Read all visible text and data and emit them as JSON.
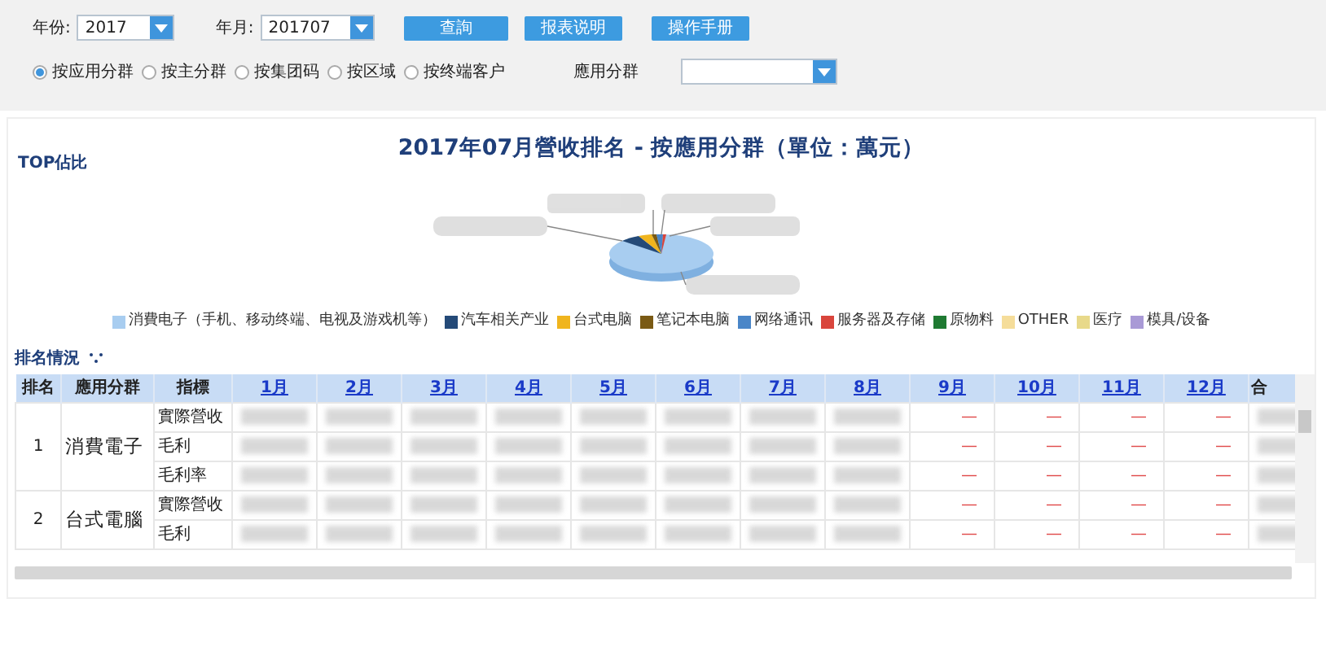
{
  "filters": {
    "year": {
      "label": "年份:",
      "value": "2017"
    },
    "month": {
      "label": "年月:",
      "value": "201707"
    },
    "buttons": [
      "查詢",
      "报表说明",
      "操作手册"
    ],
    "radios": [
      {
        "label": "按应用分群",
        "selected": true
      },
      {
        "label": "按主分群",
        "selected": false
      },
      {
        "label": "按集团码",
        "selected": false
      },
      {
        "label": "按区域",
        "selected": false
      },
      {
        "label": "按终端客户",
        "selected": false
      }
    ],
    "group_select": {
      "label": "應用分群"
    }
  },
  "chart": {
    "title": "2017年07月營收排名 - 按應用分群（單位：萬元）",
    "side_label": "TOP佔比",
    "legend": [
      {
        "label": "消費电子（手机、移动终端、电视及游戏机等）",
        "color": "#a8cdf0"
      },
      {
        "label": "汽车相关产业",
        "color": "#244a78"
      },
      {
        "label": "台式电脑",
        "color": "#f0b51e"
      },
      {
        "label": "笔记本电脑",
        "color": "#7a5a14"
      },
      {
        "label": "网络通讯",
        "color": "#4a86c8"
      },
      {
        "label": "服务器及存储",
        "color": "#d9453c"
      },
      {
        "label": "原物料",
        "color": "#1f7a32"
      },
      {
        "label": "OTHER",
        "color": "#f5dd9a"
      },
      {
        "label": "医疗",
        "color": "#e8d98a"
      },
      {
        "label": "模具/设备",
        "color": "#a99ad6"
      }
    ]
  },
  "ranking": {
    "title": "排名情況",
    "columns": [
      "排名",
      "應用分群",
      "指標",
      "1月",
      "2月",
      "3月",
      "4月",
      "5月",
      "6月",
      "7月",
      "8月",
      "9月",
      "10月",
      "11月",
      "12月",
      "合"
    ],
    "groups": [
      {
        "rank": "1",
        "name": "消費電子",
        "rows": [
          {
            "metric": "實際營收",
            "cells": [
              {
                "kind": "redacted"
              },
              {
                "kind": "redacted"
              },
              {
                "kind": "redacted"
              },
              {
                "kind": "redacted"
              },
              {
                "kind": "redacted"
              },
              {
                "kind": "redacted"
              },
              {
                "kind": "redacted"
              },
              {
                "kind": "redacted"
              },
              {
                "kind": "text",
                "text": "—"
              },
              {
                "kind": "text",
                "text": "—"
              },
              {
                "kind": "text",
                "text": "—"
              },
              {
                "kind": "text",
                "text": "—"
              },
              {
                "kind": "redacted"
              }
            ]
          },
          {
            "metric": "毛利",
            "cells": [
              {
                "kind": "redacted"
              },
              {
                "kind": "redacted"
              },
              {
                "kind": "redacted"
              },
              {
                "kind": "redacted"
              },
              {
                "kind": "redacted"
              },
              {
                "kind": "redacted"
              },
              {
                "kind": "redacted"
              },
              {
                "kind": "redacted"
              },
              {
                "kind": "text",
                "text": "—"
              },
              {
                "kind": "text",
                "text": "—"
              },
              {
                "kind": "text",
                "text": "—"
              },
              {
                "kind": "text",
                "text": "—"
              },
              {
                "kind": "redacted"
              }
            ]
          },
          {
            "metric": "毛利率",
            "cells": [
              {
                "kind": "redacted"
              },
              {
                "kind": "redacted"
              },
              {
                "kind": "redacted"
              },
              {
                "kind": "redacted"
              },
              {
                "kind": "redacted"
              },
              {
                "kind": "redacted"
              },
              {
                "kind": "redacted"
              },
              {
                "kind": "redacted"
              },
              {
                "kind": "text",
                "text": "—"
              },
              {
                "kind": "text",
                "text": "—"
              },
              {
                "kind": "text",
                "text": "—"
              },
              {
                "kind": "text",
                "text": "—"
              },
              {
                "kind": "redacted"
              }
            ]
          }
        ]
      },
      {
        "rank": "2",
        "name": "台式電腦",
        "rows": [
          {
            "metric": "實際營收",
            "cells": [
              {
                "kind": "redacted"
              },
              {
                "kind": "redacted"
              },
              {
                "kind": "redacted"
              },
              {
                "kind": "redacted"
              },
              {
                "kind": "redacted"
              },
              {
                "kind": "redacted"
              },
              {
                "kind": "redacted"
              },
              {
                "kind": "redacted"
              },
              {
                "kind": "text",
                "text": "—"
              },
              {
                "kind": "text",
                "text": "—"
              },
              {
                "kind": "text",
                "text": "—"
              },
              {
                "kind": "text",
                "text": "—"
              },
              {
                "kind": "redacted"
              }
            ]
          },
          {
            "metric": "毛利",
            "cells": [
              {
                "kind": "redacted"
              },
              {
                "kind": "redacted"
              },
              {
                "kind": "redacted"
              },
              {
                "kind": "redacted"
              },
              {
                "kind": "redacted"
              },
              {
                "kind": "redacted"
              },
              {
                "kind": "redacted"
              },
              {
                "kind": "redacted"
              },
              {
                "kind": "text",
                "text": "—"
              },
              {
                "kind": "text",
                "text": "—"
              },
              {
                "kind": "text",
                "text": "—"
              },
              {
                "kind": "text",
                "text": "—"
              },
              {
                "kind": "redacted"
              }
            ]
          }
        ]
      }
    ]
  }
}
